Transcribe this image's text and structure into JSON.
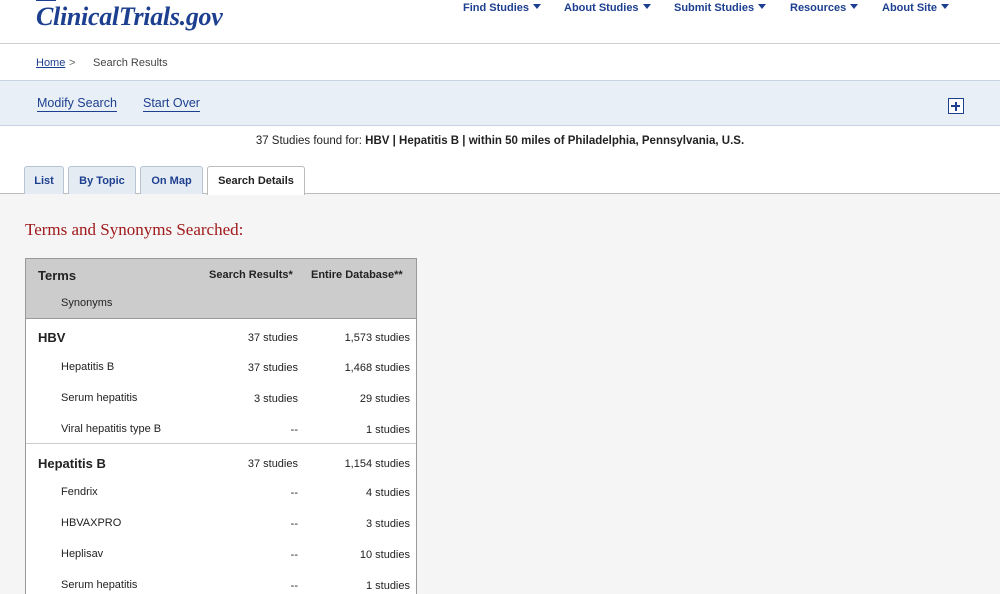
{
  "header": {
    "logo": "ClinicalTrials.gov",
    "nav": [
      {
        "label": "Find Studies"
      },
      {
        "label": "About Studies"
      },
      {
        "label": "Submit Studies"
      },
      {
        "label": "Resources"
      },
      {
        "label": "About Site"
      }
    ]
  },
  "breadcrumb": {
    "home": "Home",
    "separator": ">",
    "current": "Search Results"
  },
  "actions": {
    "modify": "Modify Search",
    "start_over": "Start Over"
  },
  "summary": {
    "prefix": "37 Studies found for:",
    "query": "HBV | Hepatitis B | within 50 miles of Philadelphia, Pennsylvania, U.S."
  },
  "tabs": [
    {
      "label": "List",
      "active": false
    },
    {
      "label": "By Topic",
      "active": false
    },
    {
      "label": "On Map",
      "active": false
    },
    {
      "label": "Search Details",
      "active": true
    }
  ],
  "section_title": "Terms and Synonyms Searched:",
  "table": {
    "headers": {
      "terms": "Terms",
      "synonyms": "Synonyms",
      "search_results": "Search Results*",
      "entire_database": "Entire Database**"
    },
    "rows": [
      {
        "kind": "term",
        "name": "HBV",
        "search_results": "37 studies",
        "entire_database": "1,573 studies"
      },
      {
        "kind": "synonym",
        "name": "Hepatitis B",
        "search_results": "37 studies",
        "entire_database": "1,468 studies"
      },
      {
        "kind": "synonym",
        "name": "Serum hepatitis",
        "search_results": "3 studies",
        "entire_database": "29 studies"
      },
      {
        "kind": "synonym",
        "name": "Viral hepatitis type B",
        "search_results": "--",
        "entire_database": "1 studies"
      },
      {
        "kind": "term",
        "name": "Hepatitis B",
        "search_results": "37 studies",
        "entire_database": "1,154 studies"
      },
      {
        "kind": "synonym",
        "name": "Fendrix",
        "search_results": "--",
        "entire_database": "4 studies"
      },
      {
        "kind": "synonym",
        "name": "HBVAXPRO",
        "search_results": "--",
        "entire_database": "3 studies"
      },
      {
        "kind": "synonym",
        "name": "Heplisav",
        "search_results": "--",
        "entire_database": "10 studies"
      },
      {
        "kind": "synonym",
        "name": "Serum hepatitis",
        "search_results": "--",
        "entire_database": "1 studies"
      }
    ]
  },
  "colors": {
    "brand_blue": "#1d3f8f",
    "title_red": "#a0191b",
    "action_bar_bg": "#e9eff6",
    "table_header_bg": "#cccccc"
  },
  "icons": {
    "expand": "plus-box-icon",
    "nav_caret": "caret-down-icon"
  }
}
